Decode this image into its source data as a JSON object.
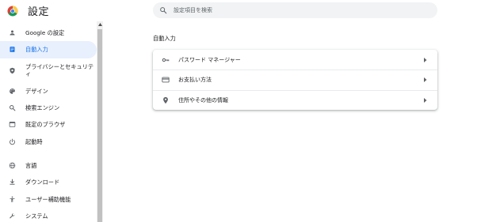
{
  "header": {
    "title": "設定"
  },
  "search": {
    "placeholder": "設定項目を検索"
  },
  "sidebar": {
    "items": [
      {
        "label": "Google の設定",
        "icon": "person-icon"
      },
      {
        "label": "自動入力",
        "icon": "autofill-icon",
        "active": true
      },
      {
        "label": "プライバシーとセキュリティ",
        "icon": "shield-icon"
      },
      {
        "label": "デザイン",
        "icon": "palette-icon"
      },
      {
        "label": "検索エンジン",
        "icon": "search-icon"
      },
      {
        "label": "既定のブラウザ",
        "icon": "browser-icon"
      },
      {
        "label": "起動時",
        "icon": "power-icon"
      },
      {
        "label": "言語",
        "icon": "globe-icon"
      },
      {
        "label": "ダウンロード",
        "icon": "download-icon"
      },
      {
        "label": "ユーザー補助機能",
        "icon": "accessibility-icon"
      },
      {
        "label": "システム",
        "icon": "wrench-icon"
      }
    ]
  },
  "main": {
    "section_title": "自動入力",
    "rows": [
      {
        "label": "パスワード マネージャー",
        "icon": "key-icon"
      },
      {
        "label": "お支払い方法",
        "icon": "credit-card-icon"
      },
      {
        "label": "住所やその他の情報",
        "icon": "location-pin-icon"
      }
    ]
  },
  "colors": {
    "accent": "#1a73e8",
    "active_bg": "#e8f0fe",
    "icon": "#5f6368"
  }
}
